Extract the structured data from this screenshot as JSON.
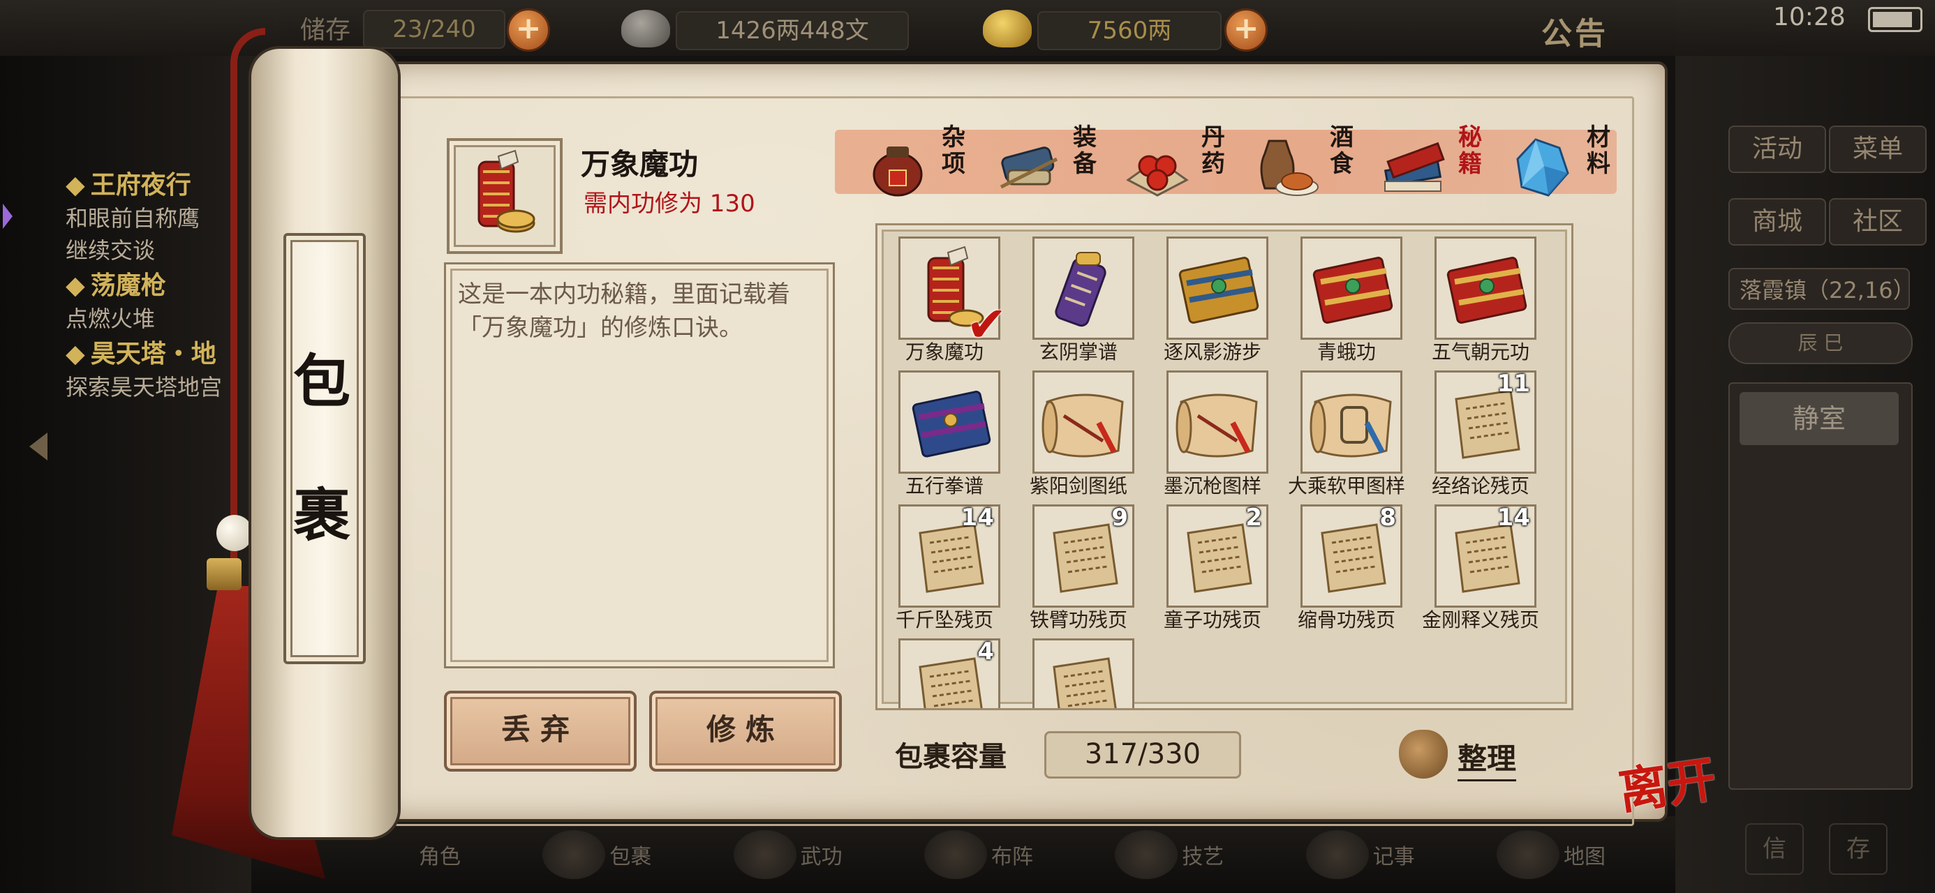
{
  "topbar": {
    "stat_left": "23/240",
    "stat_left_prefix": "储存",
    "silver": "1426两448文",
    "gold": "7560两",
    "notice_label": "公告",
    "time": "10:28"
  },
  "quests": [
    {
      "title": "王府夜行",
      "desc": [
        "和眼前自称鹰",
        "继续交谈"
      ]
    },
    {
      "title": "荡魔枪",
      "desc": [
        "点燃火堆"
      ]
    },
    {
      "title": "昊天塔・地",
      "desc": [
        "探索昊天塔地宫"
      ]
    }
  ],
  "right_menu": {
    "buttons": [
      "活动",
      "菜单",
      "商城",
      "社区"
    ],
    "location": "落霞镇（22,16）",
    "time_strip": "辰 巳",
    "room": "静室"
  },
  "bottom_nav": [
    "角色",
    "包裹",
    "武功",
    "布阵",
    "技艺",
    "记事",
    "地图"
  ],
  "bottom_small": [
    "信",
    "存"
  ],
  "panel": {
    "title_chars": [
      "包",
      "裹"
    ],
    "selected": {
      "name": "万象魔功",
      "requirement": "需内功修为 130",
      "description": "这是一本内功秘籍，里面记载着「万象魔功」的修炼口诀。"
    },
    "buttons": {
      "discard": "丢弃",
      "practice": "修炼"
    },
    "tabs": [
      {
        "label": "杂项",
        "icon": "jar-icon",
        "active": false
      },
      {
        "label": "装备",
        "icon": "equipment-icon",
        "active": false
      },
      {
        "label": "丹药",
        "icon": "pill-icon",
        "active": false
      },
      {
        "label": "酒食",
        "icon": "food-icon",
        "active": false
      },
      {
        "label": "秘籍",
        "icon": "book-icon",
        "active": true
      },
      {
        "label": "材料",
        "icon": "crystal-icon",
        "active": false
      }
    ],
    "items": [
      {
        "label": "万象魔功",
        "icon": "scroll-red",
        "count": "",
        "selected": true
      },
      {
        "label": "玄阴掌谱",
        "icon": "scroll-purple",
        "count": "",
        "selected": false
      },
      {
        "label": "逐风影游步",
        "icon": "book-gold",
        "count": "",
        "selected": false
      },
      {
        "label": "青蛾功",
        "icon": "book-red",
        "count": "",
        "selected": false
      },
      {
        "label": "五气朝元功",
        "icon": "book-red",
        "count": "",
        "selected": false
      },
      {
        "label": "五行拳谱",
        "icon": "book-blue",
        "count": "",
        "selected": false
      },
      {
        "label": "紫阳剑图纸",
        "icon": "blueprint",
        "count": "",
        "selected": false
      },
      {
        "label": "墨沉枪图样",
        "icon": "blueprint",
        "count": "",
        "selected": false
      },
      {
        "label": "大乘软甲图样",
        "icon": "blueprint-blue",
        "count": "",
        "selected": false
      },
      {
        "label": "经络论残页",
        "icon": "page",
        "count": "11",
        "selected": false
      },
      {
        "label": "千斤坠残页",
        "icon": "page",
        "count": "14",
        "selected": false
      },
      {
        "label": "铁臂功残页",
        "icon": "page",
        "count": "9",
        "selected": false
      },
      {
        "label": "童子功残页",
        "icon": "page",
        "count": "2",
        "selected": false
      },
      {
        "label": "缩骨功残页",
        "icon": "page",
        "count": "8",
        "selected": false
      },
      {
        "label": "金刚释义残页",
        "icon": "page",
        "count": "14",
        "selected": false
      },
      {
        "label": "",
        "icon": "page",
        "count": "4",
        "selected": false
      },
      {
        "label": "",
        "icon": "page",
        "count": "",
        "selected": false
      }
    ],
    "capacity_label": "包裹容量",
    "capacity_value": "317/330",
    "sort_label": "整理",
    "leave_label": "离开"
  },
  "colors": {
    "requirement_red": "#b0151a",
    "active_tab": "#b0151a",
    "parchment": "#e6dcc8"
  }
}
